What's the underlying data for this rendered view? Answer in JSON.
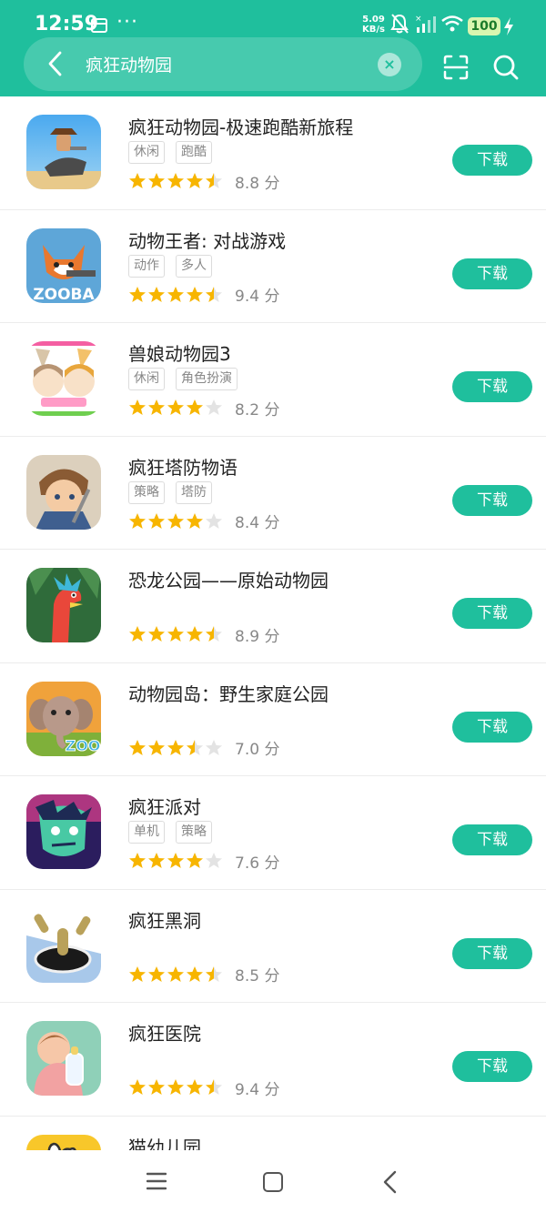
{
  "status_bar": {
    "time": "12:59",
    "dots": "···",
    "net_speed": "5.09",
    "net_unit": "KB/s",
    "battery": "100"
  },
  "search": {
    "query": "疯狂动物园",
    "clear_label": "×"
  },
  "download_label": "下载",
  "colors": {
    "accent": "#1fbf9d",
    "star": "#f7b500",
    "star_empty": "#e3e3e3"
  },
  "apps": [
    {
      "title": "疯狂动物园-极速跑酷新旅程",
      "tags": [
        "休闲",
        "跑酷"
      ],
      "rating": 4.5,
      "score": "8.8 分",
      "icon": "cowboy-bull-icon"
    },
    {
      "title": "动物王者: 对战游戏",
      "tags": [
        "动作",
        "多人"
      ],
      "rating": 4.5,
      "score": "9.4 分",
      "icon": "zooba-fox-icon"
    },
    {
      "title": "兽娘动物园3",
      "tags": [
        "休闲",
        "角色扮演"
      ],
      "rating": 4,
      "score": "8.2 分",
      "icon": "anime-girls-icon"
    },
    {
      "title": "疯狂塔防物语",
      "tags": [
        "策略",
        "塔防"
      ],
      "rating": 4,
      "score": "8.4 分",
      "icon": "warrior-boy-icon"
    },
    {
      "title": "恐龙公园——原始动物园",
      "tags": [],
      "rating": 4.5,
      "score": "8.9 分",
      "icon": "dinosaur-icon"
    },
    {
      "title": "动物园岛：野生家庭公园",
      "tags": [],
      "rating": 3.5,
      "score": "7.0 分",
      "icon": "elephant-zoo-icon"
    },
    {
      "title": "疯狂派对",
      "tags": [
        "单机",
        "策略"
      ],
      "rating": 4,
      "score": "7.6 分",
      "icon": "zombie-face-icon"
    },
    {
      "title": "疯狂黑洞",
      "tags": [],
      "rating": 4.5,
      "score": "8.5 分",
      "icon": "black-hole-icon"
    },
    {
      "title": "疯狂医院",
      "tags": [],
      "rating": 4.5,
      "score": "9.4 分",
      "icon": "baby-bottle-icon"
    },
    {
      "title": "猫幼儿园",
      "tags": [],
      "rating": 0,
      "score": "",
      "icon": "cat-face-icon"
    }
  ]
}
